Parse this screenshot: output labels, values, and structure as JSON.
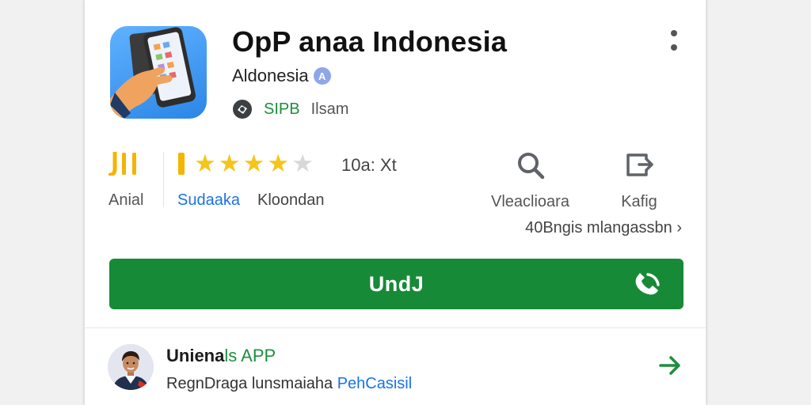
{
  "app": {
    "title": "OpP anaa Indonesia",
    "developer": "Aldonesia",
    "verified_badge": "A",
    "tag_primary": "SIPB",
    "tag_secondary": "Ilsam",
    "icon": "app-hand-phone-icon"
  },
  "stats": {
    "label": "Anial",
    "rating_count": "10a: Xt",
    "stars": {
      "filled": 4,
      "total": 5
    },
    "category": "Sudaaka",
    "category_extra": "Kloondan"
  },
  "actions": {
    "search_label": "Vleaclioara",
    "share_label": "Kafig"
  },
  "info_link": "40Bngis mlangassbn",
  "install": {
    "label": "UndJ"
  },
  "review": {
    "title": "Uniena",
    "title_highlight": "ls APP",
    "subtitle": "RegnDraga lunsmaiaha ",
    "subtitle_link": "PehCasisil"
  },
  "colors": {
    "accent_green": "#178a37",
    "link_blue": "#1a73e8",
    "star_yellow": "#f5c518",
    "icon_blue": "#2c86e6"
  }
}
